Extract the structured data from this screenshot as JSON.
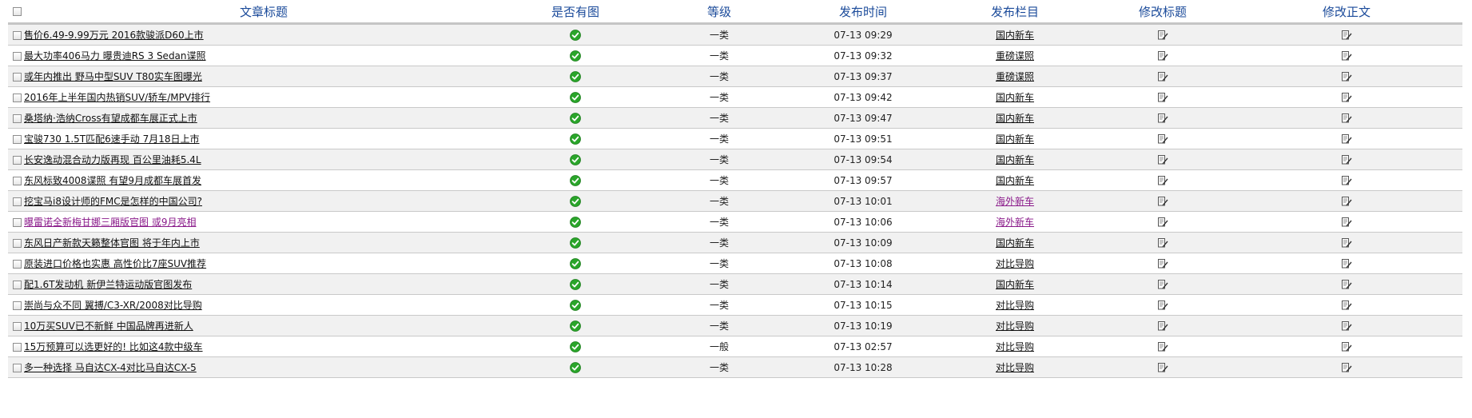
{
  "header": {
    "title": "文章标题",
    "has_image": "是否有图",
    "level": "等级",
    "publish_time": "发布时间",
    "column": "发布栏目",
    "edit_title": "修改标题",
    "edit_body": "修改正文"
  },
  "colors": {
    "header_text": "#1a4a9a",
    "visited_link": "#8a1a8a",
    "check_green": "#2aa52a"
  },
  "rows": [
    {
      "title": "售价6.49-9.99万元 2016款骏派D60上市",
      "has_image": "check-icon",
      "level": "一类",
      "time": "07-13 09:29",
      "column": "国内新车",
      "title_visited": false,
      "column_visited": false
    },
    {
      "title": "最大功率406马力 曝贵迪RS 3 Sedan谍照",
      "has_image": "check-icon",
      "level": "一类",
      "time": "07-13 09:32",
      "column": "重磅谍照",
      "title_visited": false,
      "column_visited": false
    },
    {
      "title": "或年内推出 野马中型SUV T80实车图曝光",
      "has_image": "check-icon",
      "level": "一类",
      "time": "07-13 09:37",
      "column": "重磅谍照",
      "title_visited": false,
      "column_visited": false
    },
    {
      "title": "2016年上半年国内热销SUV/轿车/MPV排行",
      "has_image": "check-icon",
      "level": "一类",
      "time": "07-13 09:42",
      "column": "国内新车",
      "title_visited": false,
      "column_visited": false
    },
    {
      "title": "桑塔纳·浩纳Cross有望成都车展正式上市",
      "has_image": "check-icon",
      "level": "一类",
      "time": "07-13 09:47",
      "column": "国内新车",
      "title_visited": false,
      "column_visited": false
    },
    {
      "title": "宝骏730 1.5T匹配6速手动 7月18日上市",
      "has_image": "check-icon",
      "level": "一类",
      "time": "07-13 09:51",
      "column": "国内新车",
      "title_visited": false,
      "column_visited": false
    },
    {
      "title": "长安逸动混合动力版再现 百公里油耗5.4L",
      "has_image": "check-icon",
      "level": "一类",
      "time": "07-13 09:54",
      "column": "国内新车",
      "title_visited": false,
      "column_visited": false
    },
    {
      "title": "东风标致4008谍照 有望9月成都车展首发",
      "has_image": "check-icon",
      "level": "一类",
      "time": "07-13 09:57",
      "column": "国内新车",
      "title_visited": false,
      "column_visited": false
    },
    {
      "title": "挖宝马i8设计师的FMC是怎样的中国公司?",
      "has_image": "check-icon",
      "level": "一类",
      "time": "07-13 10:01",
      "column": "海外新车",
      "title_visited": false,
      "column_visited": true
    },
    {
      "title": "曝雷诺全新梅甘娜三厢版官图 或9月亮相",
      "has_image": "check-icon",
      "level": "一类",
      "time": "07-13 10:06",
      "column": "海外新车",
      "title_visited": true,
      "column_visited": true
    },
    {
      "title": "东风日产新款天籁整体官图 将于年内上市",
      "has_image": "check-icon",
      "level": "一类",
      "time": "07-13 10:09",
      "column": "国内新车",
      "title_visited": false,
      "column_visited": false
    },
    {
      "title": "原装进口价格也实惠 高性价比7座SUV推荐",
      "has_image": "check-icon",
      "level": "一类",
      "time": "07-13 10:08",
      "column": "对比导购",
      "title_visited": false,
      "column_visited": false
    },
    {
      "title": "配1.6T发动机 新伊兰特运动版官图发布",
      "has_image": "check-icon",
      "level": "一类",
      "time": "07-13 10:14",
      "column": "国内新车",
      "title_visited": false,
      "column_visited": false
    },
    {
      "title": "崇尚与众不同 翼搏/C3-XR/2008对比导购",
      "has_image": "check-icon",
      "level": "一类",
      "time": "07-13 10:15",
      "column": "对比导购",
      "title_visited": false,
      "column_visited": false
    },
    {
      "title": "10万买SUV已不新鲜 中国品牌再进新人",
      "has_image": "check-icon",
      "level": "一类",
      "time": "07-13 10:19",
      "column": "对比导购",
      "title_visited": false,
      "column_visited": false
    },
    {
      "title": "15万预算可以选更好的! 比如这4款中级车",
      "has_image": "check-icon",
      "level": "一般",
      "time": "07-13 02:57",
      "column": "对比导购",
      "title_visited": false,
      "column_visited": false
    },
    {
      "title": "多一种选择 马自达CX-4对比马自达CX-5",
      "has_image": "check-icon",
      "level": "一类",
      "time": "07-13 10:28",
      "column": "对比导购",
      "title_visited": false,
      "column_visited": false
    }
  ]
}
